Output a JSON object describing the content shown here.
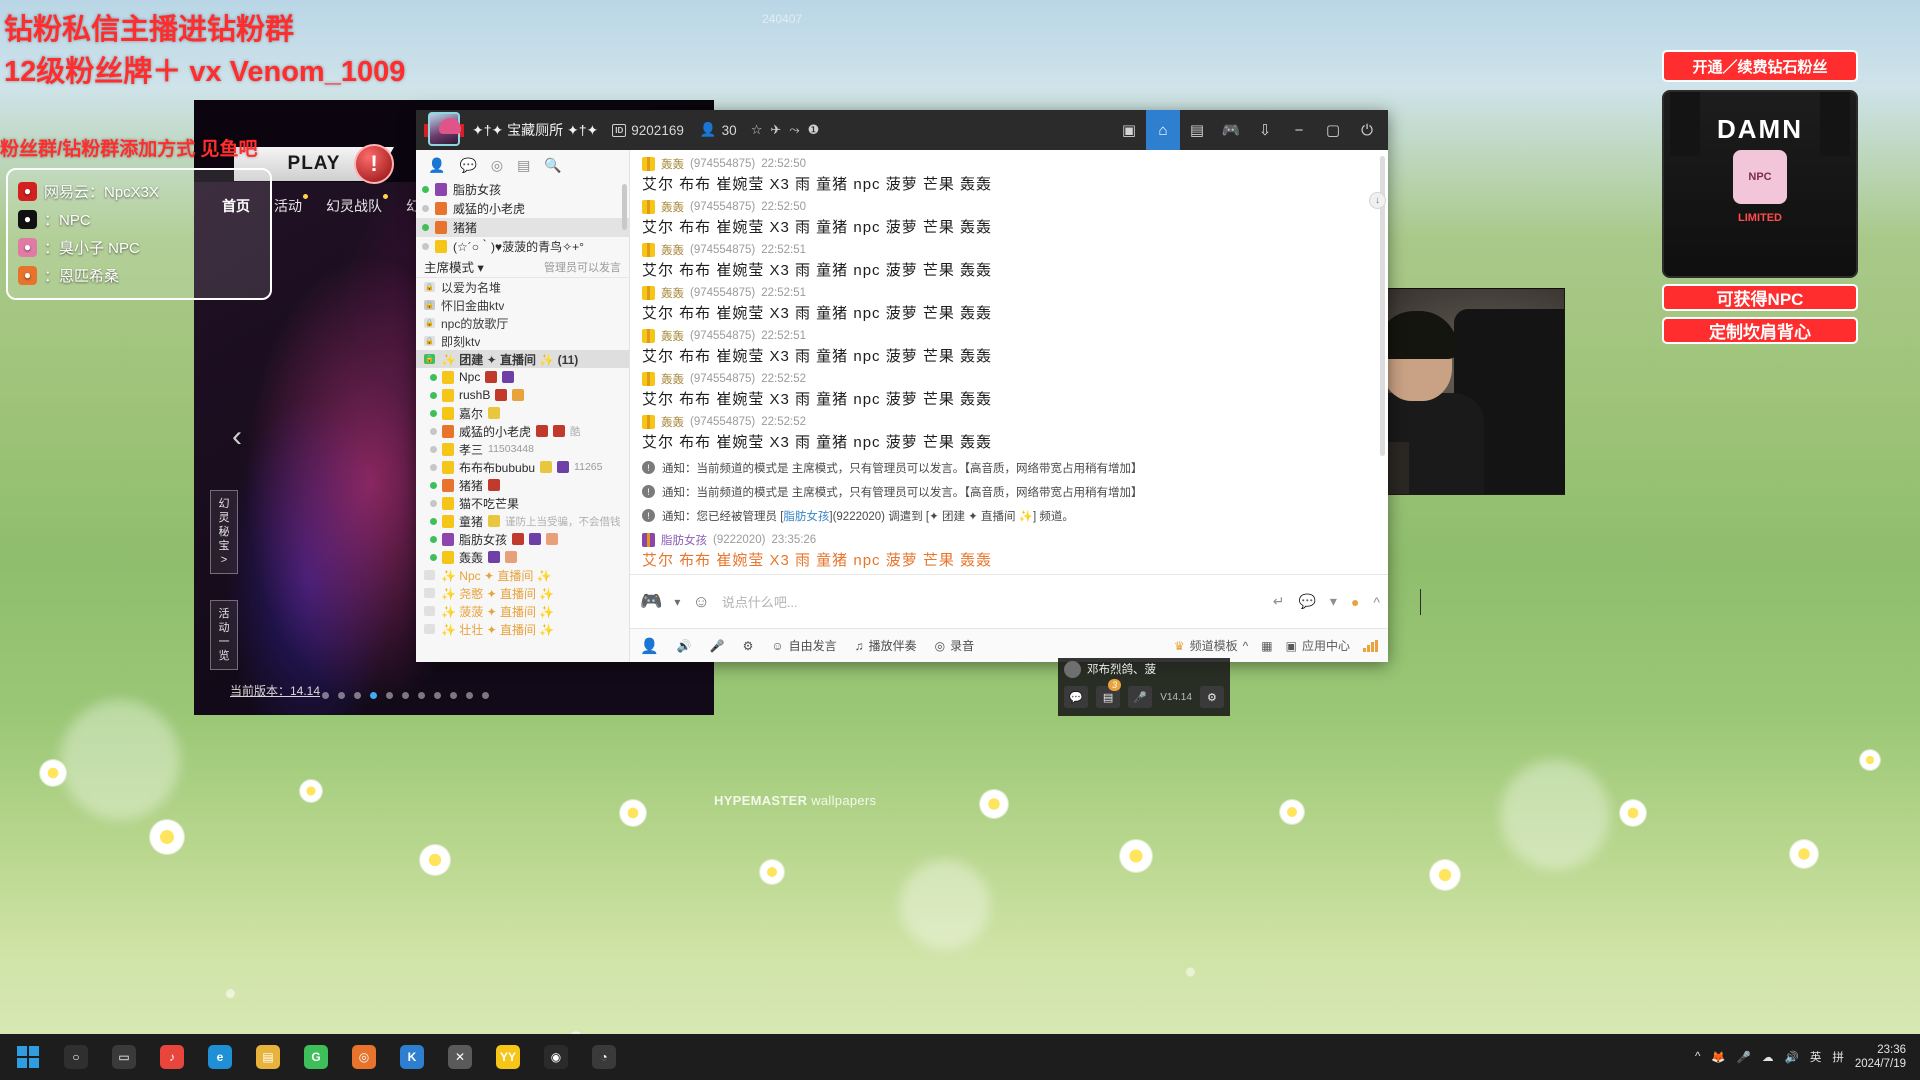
{
  "desktop": {
    "watermark_brand": "HYPEMASTER",
    "watermark_rest": " wallpapers",
    "top_code": "240407"
  },
  "overlay": {
    "caption_line1": "钻粉私信主播进钻粉群",
    "caption_line2": "12级粉丝牌＋ vx Venom_1009",
    "caption_line3": "粉丝群/钻粉群添加方式 见鱼吧",
    "contacts": [
      {
        "icon": "cloud-music-icon",
        "label": "网易云：NpcX3X",
        "color": "#d42020"
      },
      {
        "icon": "tiktok-icon",
        "label": "：NPC",
        "color": "#111111"
      },
      {
        "icon": "bilibili-icon",
        "label": "：臭小子 NPC",
        "color": "#e07ba6"
      },
      {
        "icon": "eye-icon",
        "label": "：恩匹希桑",
        "color": "#e8732c"
      }
    ]
  },
  "promo": {
    "title": "开通／续费钻石粉丝",
    "shirt_brand": "DAMN",
    "shirt_chip": "NPC",
    "shirt_sub": "LIMITED",
    "line1": "可获得NPC",
    "line2": "定制坎肩背心"
  },
  "game": {
    "play_label": "PLAY",
    "error_icon": "alert-icon",
    "nav": [
      "首页",
      "活动",
      "幻灵战队",
      "幻灵秘..."
    ],
    "side_buttons": [
      "幻灵秘宝 >",
      "活动一览"
    ],
    "version": "当前版本：14.14",
    "carousel_dots": 11,
    "carousel_active": 3
  },
  "im": {
    "title": {
      "room_name": "✦†✦ 宝藏厕所 ✦†✦",
      "id_label": "ID",
      "id_value": "9202169",
      "member_icon": "person-icon",
      "member_count": "30",
      "icons": [
        "star-icon",
        "airplane-icon",
        "share-icon",
        "info-icon"
      ],
      "right_icons": [
        "screen-icon",
        "home-icon",
        "board-icon",
        "gamepad-icon",
        "download-icon"
      ],
      "window_buttons": [
        "minimize-icon",
        "maximize-icon",
        "power-icon"
      ]
    },
    "left_panel": {
      "tool_icons": [
        "contact-icon",
        "chat-icon",
        "location-icon",
        "notice-icon",
        "search-icon"
      ],
      "groups": [
        {
          "name": "脂肪女孩",
          "online": true,
          "shirt": "#8e44ad"
        },
        {
          "name": "威猛的小老虎",
          "online": false,
          "shirt": "#e8732c"
        },
        {
          "name": "猪猪",
          "online": true,
          "shirt": "#e8732c",
          "selected": true
        },
        {
          "name": "(☆´○｀)♥菠菠的青鸟✧+°",
          "online": false,
          "shirt": "#f5c518"
        }
      ],
      "mode_label": "主席模式",
      "mode_hint": "管理员可以发言",
      "channels": [
        {
          "name": "以爱为名堆",
          "lock": "dim"
        },
        {
          "name": "怀旧金曲ktv",
          "lock": "grey"
        },
        {
          "name": "npc的放歌厅",
          "lock": "dim"
        },
        {
          "name": "即刻ktv",
          "lock": "dim"
        },
        {
          "name": "✨ 团建 ✦ 直播间 ✨ (11)",
          "lock": "green",
          "current": true
        }
      ],
      "members": [
        {
          "name": "Npc",
          "online": true,
          "shirt": "#f5c518",
          "badges": [
            "crown",
            "purple"
          ]
        },
        {
          "name": "rushB",
          "online": true,
          "shirt": "#f5c518",
          "badges": [
            "crown",
            "tag"
          ]
        },
        {
          "name": "嘉尔",
          "online": true,
          "shirt": "#f5c518",
          "badges": [
            "crown-y"
          ]
        },
        {
          "name": "威猛的小老虎",
          "online": false,
          "shirt": "#e8732c",
          "badges": [
            "crown",
            "red"
          ],
          "note": "酷"
        },
        {
          "name": "孝三",
          "online": false,
          "shirt": "#f5c518",
          "badges": [],
          "num": "11503448"
        },
        {
          "name": "布布布bububu",
          "online": false,
          "shirt": "#f5c518",
          "badges": [
            "crown-y",
            "purple"
          ],
          "num": "11265"
        },
        {
          "name": "猪猪",
          "online": true,
          "shirt": "#e8732c",
          "badges": [
            "crown"
          ]
        },
        {
          "name": "猫不吃芒果",
          "online": false,
          "shirt": "#f5c518",
          "badges": []
        },
        {
          "name": "童猪",
          "online": true,
          "shirt": "#f5c518",
          "badges": [
            "crown-y"
          ],
          "note": "谨防上当受骗，不会借钱"
        },
        {
          "name": "脂肪女孩",
          "online": true,
          "shirt": "#8e44ad",
          "badges": [
            "crown",
            "purple",
            "orange"
          ]
        },
        {
          "name": "轰轰",
          "online": true,
          "shirt": "#f5c518",
          "badges": [
            "purple",
            "orange"
          ]
        }
      ],
      "sub_channels": [
        "✨ Npc ✦ 直播间 ✨",
        "✨ 尧憨 ✦ 直播间 ✨",
        "✨ 菠菠 ✦ 直播间 ✨",
        "✨ 壮壮 ✦ 直播间 ✨"
      ]
    },
    "messages": [
      {
        "sender": "轰轰",
        "uid": "(974554875)",
        "time": "22:52:50",
        "text": "艾尔 布布 崔婉莹 X3 雨 童猪 npc 菠萝 芒果 轰轰"
      },
      {
        "sender": "轰轰",
        "uid": "(974554875)",
        "time": "22:52:50",
        "text": "艾尔 布布 崔婉莹 X3 雨 童猪 npc 菠萝 芒果 轰轰"
      },
      {
        "sender": "轰轰",
        "uid": "(974554875)",
        "time": "22:52:51",
        "text": "艾尔 布布 崔婉莹 X3 雨 童猪 npc 菠萝 芒果 轰轰"
      },
      {
        "sender": "轰轰",
        "uid": "(974554875)",
        "time": "22:52:51",
        "text": "艾尔 布布 崔婉莹 X3 雨 童猪 npc 菠萝 芒果 轰轰"
      },
      {
        "sender": "轰轰",
        "uid": "(974554875)",
        "time": "22:52:51",
        "text": "艾尔 布布 崔婉莹 X3 雨 童猪 npc 菠萝 芒果 轰轰"
      },
      {
        "sender": "轰轰",
        "uid": "(974554875)",
        "time": "22:52:52",
        "text": "艾尔 布布 崔婉莹 X3 雨 童猪 npc 菠萝 芒果 轰轰"
      },
      {
        "sender": "轰轰",
        "uid": "(974554875)",
        "time": "22:52:52",
        "text": "艾尔 布布 崔婉莹 X3 雨 童猪 npc 菠萝 芒果 轰轰"
      }
    ],
    "notices": [
      "通知：当前频道的模式是 主席模式，只有管理员可以发言。【高音质，网络带宽占用稍有增加】",
      "通知：当前频道的模式是 主席模式，只有管理员可以发言。【高音质，网络带宽占用稍有增加】"
    ],
    "notice_move": {
      "prefix": "通知：您已经被管理员 [",
      "actor": "脂肪女孩",
      "actor_uid": "](9222020) 调遣到 [",
      "target": "✦ 团建 ✦ 直播间 ✨",
      "suffix": "] 频道。"
    },
    "own_message": {
      "sender": "脂肪女孩",
      "uid": "(9222020)",
      "time": "23:35:26",
      "text": "艾尔 布布 崔婉莹 X3 雨 童猪 npc 菠萝 芒果 轰轰"
    },
    "composer": {
      "gamepad_icon": "gamepad-icon",
      "face_icon": "emoji-text-icon",
      "placeholder": "说点什么吧...",
      "right_icons": [
        "enter-icon",
        "comment-icon",
        "chevron-down-icon",
        "emoji-icon",
        "chevron-up-icon"
      ]
    },
    "bottom_bar": {
      "mic_user_icon": "speaker-avatar-icon",
      "items": [
        {
          "icon": "volume-icon",
          "label": ""
        },
        {
          "icon": "mic-icon",
          "label": ""
        },
        {
          "icon": "equalizer-icon",
          "label": ""
        },
        {
          "icon": "smile-icon",
          "label": "自由发言"
        },
        {
          "icon": "music-icon",
          "label": "播放伴奏"
        },
        {
          "icon": "record-icon",
          "label": "录音"
        }
      ],
      "right": [
        {
          "icon": "crown-icon",
          "label": "频道模板"
        },
        {
          "icon": "grid-icon",
          "label": ""
        },
        {
          "icon": "apps-icon",
          "label": "应用中心"
        },
        {
          "icon": "signal-icon",
          "label": ""
        }
      ]
    }
  },
  "mini_player": {
    "title": "邓布烈鸽、菠",
    "badge_count": "3",
    "version": "V14.14",
    "buttons": [
      "chat-icon",
      "board-icon",
      "mic-icon",
      "settings-icon"
    ]
  },
  "taskbar": {
    "start_icon": "windows-icon",
    "items": [
      {
        "name": "search-icon",
        "color": "#2f2f2f",
        "glyph": "○"
      },
      {
        "name": "taskview-icon",
        "color": "#3a3a3a",
        "glyph": "▭"
      },
      {
        "name": "app-music-icon",
        "color": "#e8453c",
        "glyph": "♪"
      },
      {
        "name": "app-edge-icon",
        "color": "#1f8fd6",
        "glyph": "e"
      },
      {
        "name": "app-folder-icon",
        "color": "#e8b33d",
        "glyph": "▤"
      },
      {
        "name": "app-g-icon",
        "color": "#3fbf5a",
        "glyph": "G"
      },
      {
        "name": "app-spiral-icon",
        "color": "#e8732c",
        "glyph": "◎"
      },
      {
        "name": "app-k-icon",
        "color": "#2f7fd1",
        "glyph": "K"
      },
      {
        "name": "app-cross-icon",
        "color": "#5a5a5a",
        "glyph": "✕"
      },
      {
        "name": "app-yy-icon",
        "color": "#f5c518",
        "glyph": "YY"
      },
      {
        "name": "app-dark-icon",
        "color": "#2b2b2b",
        "glyph": "◉"
      },
      {
        "name": "app-penguin-icon",
        "color": "#3a3a3a",
        "glyph": "◔"
      }
    ],
    "tray": [
      "chevron-up-icon",
      "fox-icon",
      "mic-icon",
      "cloud-icon",
      "volume-icon",
      "ime-en",
      "ime-pin"
    ],
    "ime_en": "英",
    "ime_pin": "拼",
    "clock_time": "23:36",
    "clock_date": "2024/7/19"
  }
}
